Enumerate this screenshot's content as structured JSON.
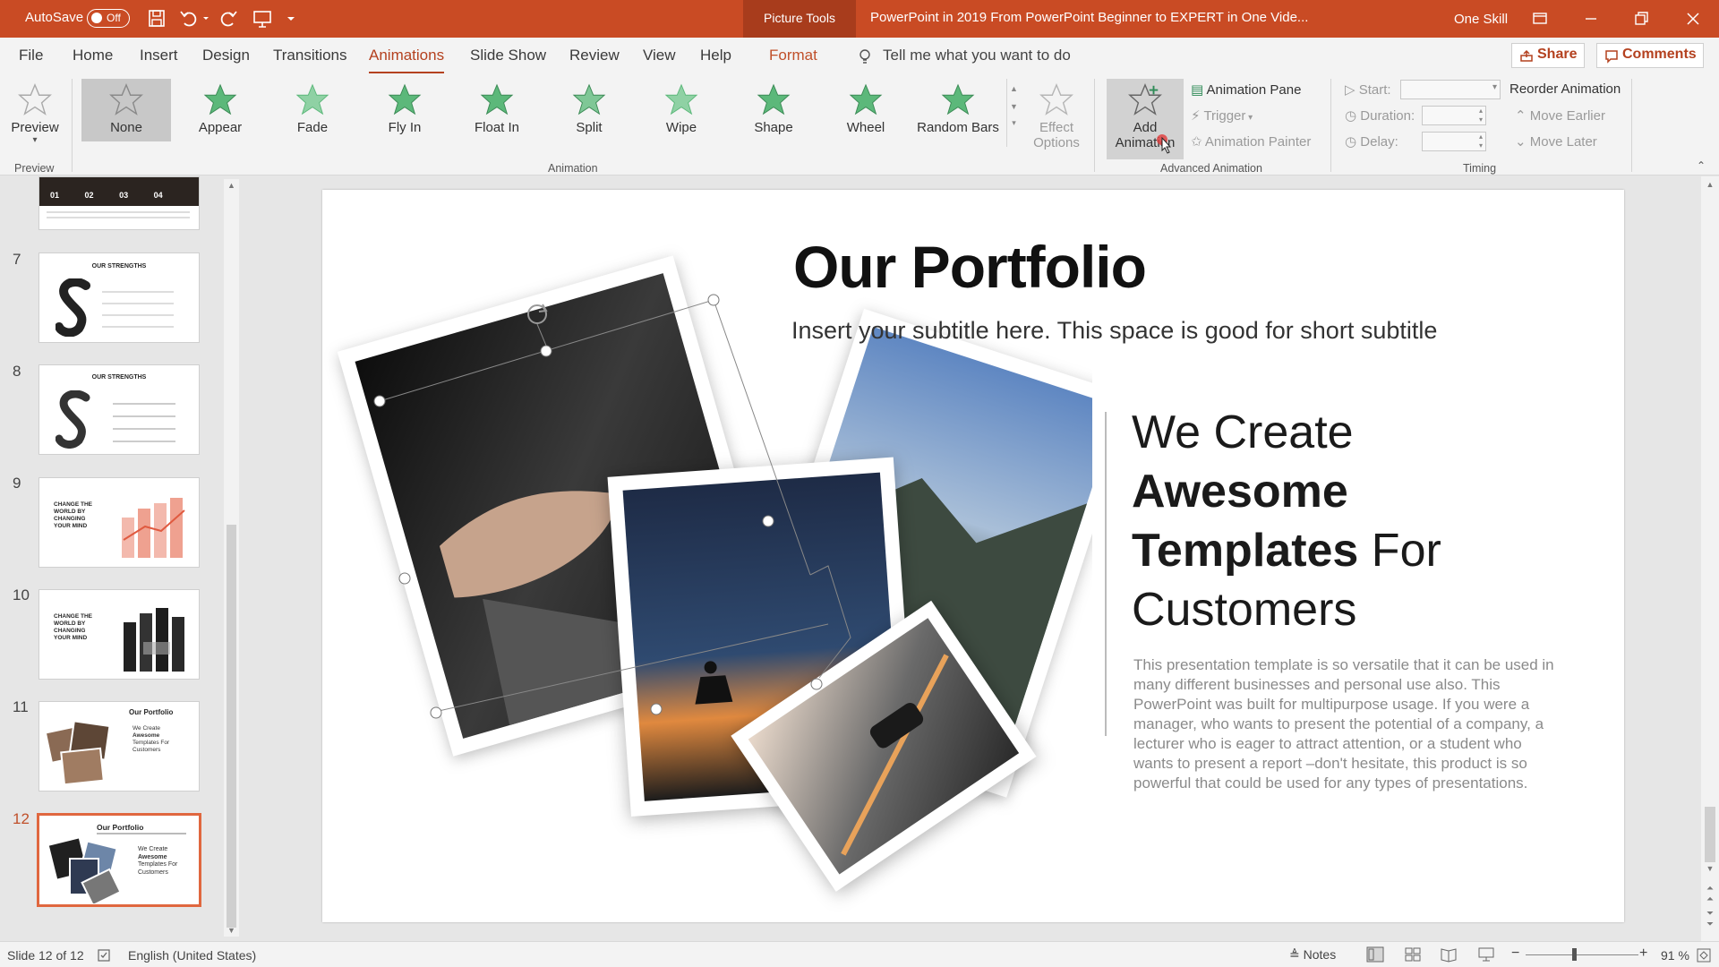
{
  "colors": {
    "accent": "#c94b24",
    "tab_active": "#b4411f",
    "ribbon_bg": "#f3f3f3",
    "star_green": "#5cb87a"
  },
  "titlebar": {
    "autosave_label": "AutoSave",
    "autosave_state": "Off",
    "context_tab": "Picture Tools",
    "doc_title": "PowerPoint in 2019 From PowerPoint Beginner to EXPERT in One Vide...",
    "user": "One Skill"
  },
  "menu": {
    "tabs": [
      "File",
      "Home",
      "Insert",
      "Design",
      "Transitions",
      "Animations",
      "Slide Show",
      "Review",
      "View",
      "Help",
      "Format"
    ],
    "active_tab": "Animations",
    "tell_me": "Tell me what you want to do",
    "share": "Share",
    "comments": "Comments"
  },
  "ribbon": {
    "preview": {
      "label": "Preview",
      "group": "Preview"
    },
    "animations": [
      "None",
      "Appear",
      "Fade",
      "Fly In",
      "Float In",
      "Split",
      "Wipe",
      "Shape",
      "Wheel",
      "Random Bars"
    ],
    "selected_animation": "None",
    "effect_options": [
      "Effect",
      "Options"
    ],
    "animation_group": "Animation",
    "add_animation": [
      "Add",
      "Animation"
    ],
    "advanced": {
      "pane": "Animation Pane",
      "trigger": "Trigger",
      "painter": "Animation Painter",
      "group": "Advanced Animation"
    },
    "timing": {
      "start": "Start:",
      "duration": "Duration:",
      "delay": "Delay:",
      "reorder": "Reorder Animation",
      "earlier": "Move Earlier",
      "later": "Move Later",
      "group": "Timing"
    }
  },
  "thumbnails": {
    "numbers": [
      "7",
      "8",
      "9",
      "10",
      "11",
      "12"
    ],
    "selected": "12",
    "t0": [
      "01",
      "02",
      "03",
      "04"
    ],
    "t7_title": "OUR STRENGTHS",
    "t8_title": "OUR STRENGTHS",
    "t9_title": [
      "CHANGE THE",
      "WORLD BY",
      "CHANGING",
      "YOUR MIND"
    ],
    "t10_title": [
      "CHANGE THE",
      "WORLD BY",
      "CHANGING",
      "YOUR MIND"
    ],
    "t11_title": "Our Portfolio",
    "t11_lines": [
      "We Create",
      "Awesome",
      "Templates For",
      "Customers"
    ],
    "t12_title": "Our Portfolio",
    "t12_lines": [
      "We Create",
      "Awesome",
      "Templates For",
      "Customers"
    ]
  },
  "slide": {
    "title": "Our Portfolio",
    "subtitle": "Insert your subtitle here. This space is good for short subtitle",
    "heading_l1": "We Create",
    "heading_bold1": "Awesome",
    "heading_bold2": "Templates",
    "heading_for": " For",
    "heading_l4": "Customers",
    "body": "This presentation template is so versatile that it can be used in many different businesses and personal use also. This PowerPoint was built for multipurpose usage. If you were a manager, who wants to present the potential of a company, a lecturer who is eager to attract attention, or a student who wants to present a report –don't hesitate, this product is so powerful that could be used for any types of presentations."
  },
  "status": {
    "slide": "Slide 12 of 12",
    "language": "English (United States)",
    "notes": "Notes",
    "zoom": "91 %"
  }
}
